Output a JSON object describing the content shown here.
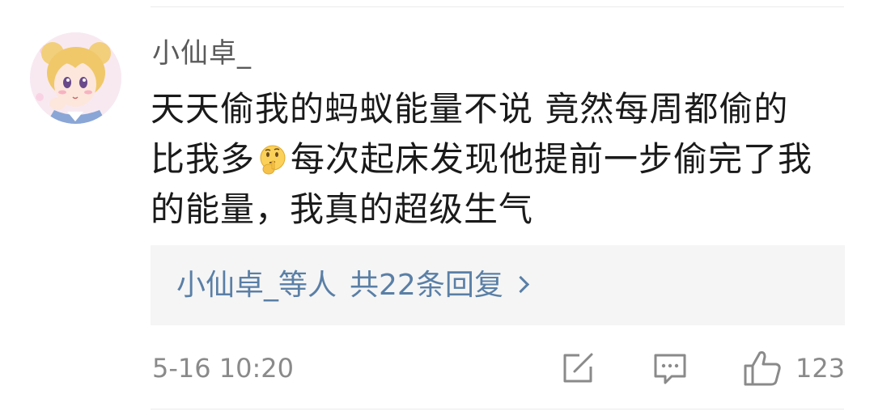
{
  "comment": {
    "avatar_icon": "anime-girl-avatar",
    "username": "小仙卓_",
    "text_lines": [
      "天天偷我的蚂蚁能量不说 竟然每周都偷的",
      "比我多",
      "每次起床发现他提前一步偷完了我",
      "的能量，我真的超级生气"
    ],
    "emoji_icon": "thinking-face-icon",
    "replies": {
      "who": "小仙卓_等人",
      "count_label": "共22条回复",
      "chevron_icon": "chevron-right-icon"
    },
    "timestamp": "5-16 10:20",
    "actions": {
      "share_icon": "share-edit-icon",
      "comment_icon": "comment-bubble-icon",
      "like_icon": "thumbs-up-icon",
      "like_count": "123"
    }
  },
  "colors": {
    "username": "#5a5a5a",
    "body_text": "#1a1a1a",
    "reply_link": "#5a7fa6",
    "meta_text": "#8a8a8a",
    "reply_box_bg": "#f5f5f5"
  }
}
